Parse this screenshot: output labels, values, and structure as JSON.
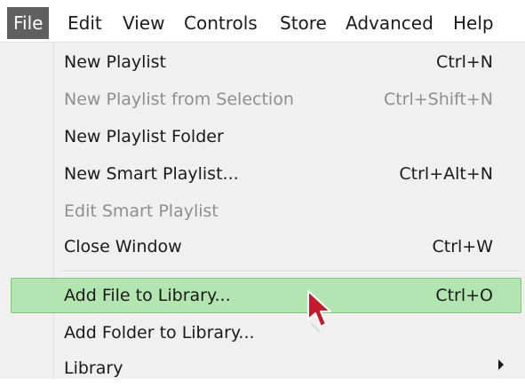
{
  "menubar": {
    "items": [
      "File",
      "Edit",
      "View",
      "Controls",
      "Store",
      "Advanced",
      "Help"
    ],
    "active": "File"
  },
  "file_menu": {
    "items": [
      {
        "label": "New Playlist",
        "shortcut": "Ctrl+N",
        "enabled": true
      },
      {
        "label": "New Playlist from Selection",
        "shortcut": "Ctrl+Shift+N",
        "enabled": false
      },
      {
        "label": "New Playlist Folder",
        "shortcut": "",
        "enabled": true
      },
      {
        "label": "New Smart Playlist...",
        "shortcut": "Ctrl+Alt+N",
        "enabled": true
      },
      {
        "label": "Edit Smart Playlist",
        "shortcut": "",
        "enabled": false
      },
      {
        "label": "Close Window",
        "shortcut": "Ctrl+W",
        "enabled": true
      },
      {
        "label": "Add File to Library...",
        "shortcut": "Ctrl+O",
        "enabled": true,
        "highlighted": true
      },
      {
        "label": "Add Folder to Library...",
        "shortcut": "",
        "enabled": true
      },
      {
        "label": "Library",
        "shortcut": "",
        "enabled": true,
        "submenu": true
      }
    ]
  },
  "colors": {
    "menubar_active_bg": "#5f5f5f",
    "menu_bg": "#f0f0f0",
    "highlight_bg": "#b3e5b1",
    "highlight_border": "#7cc97c",
    "disabled_text": "#8f8f8f",
    "cursor_color": "#c7192e"
  },
  "icons": {
    "cursor": "mouse-pointer-icon",
    "submenu": "chevron-right-icon"
  }
}
